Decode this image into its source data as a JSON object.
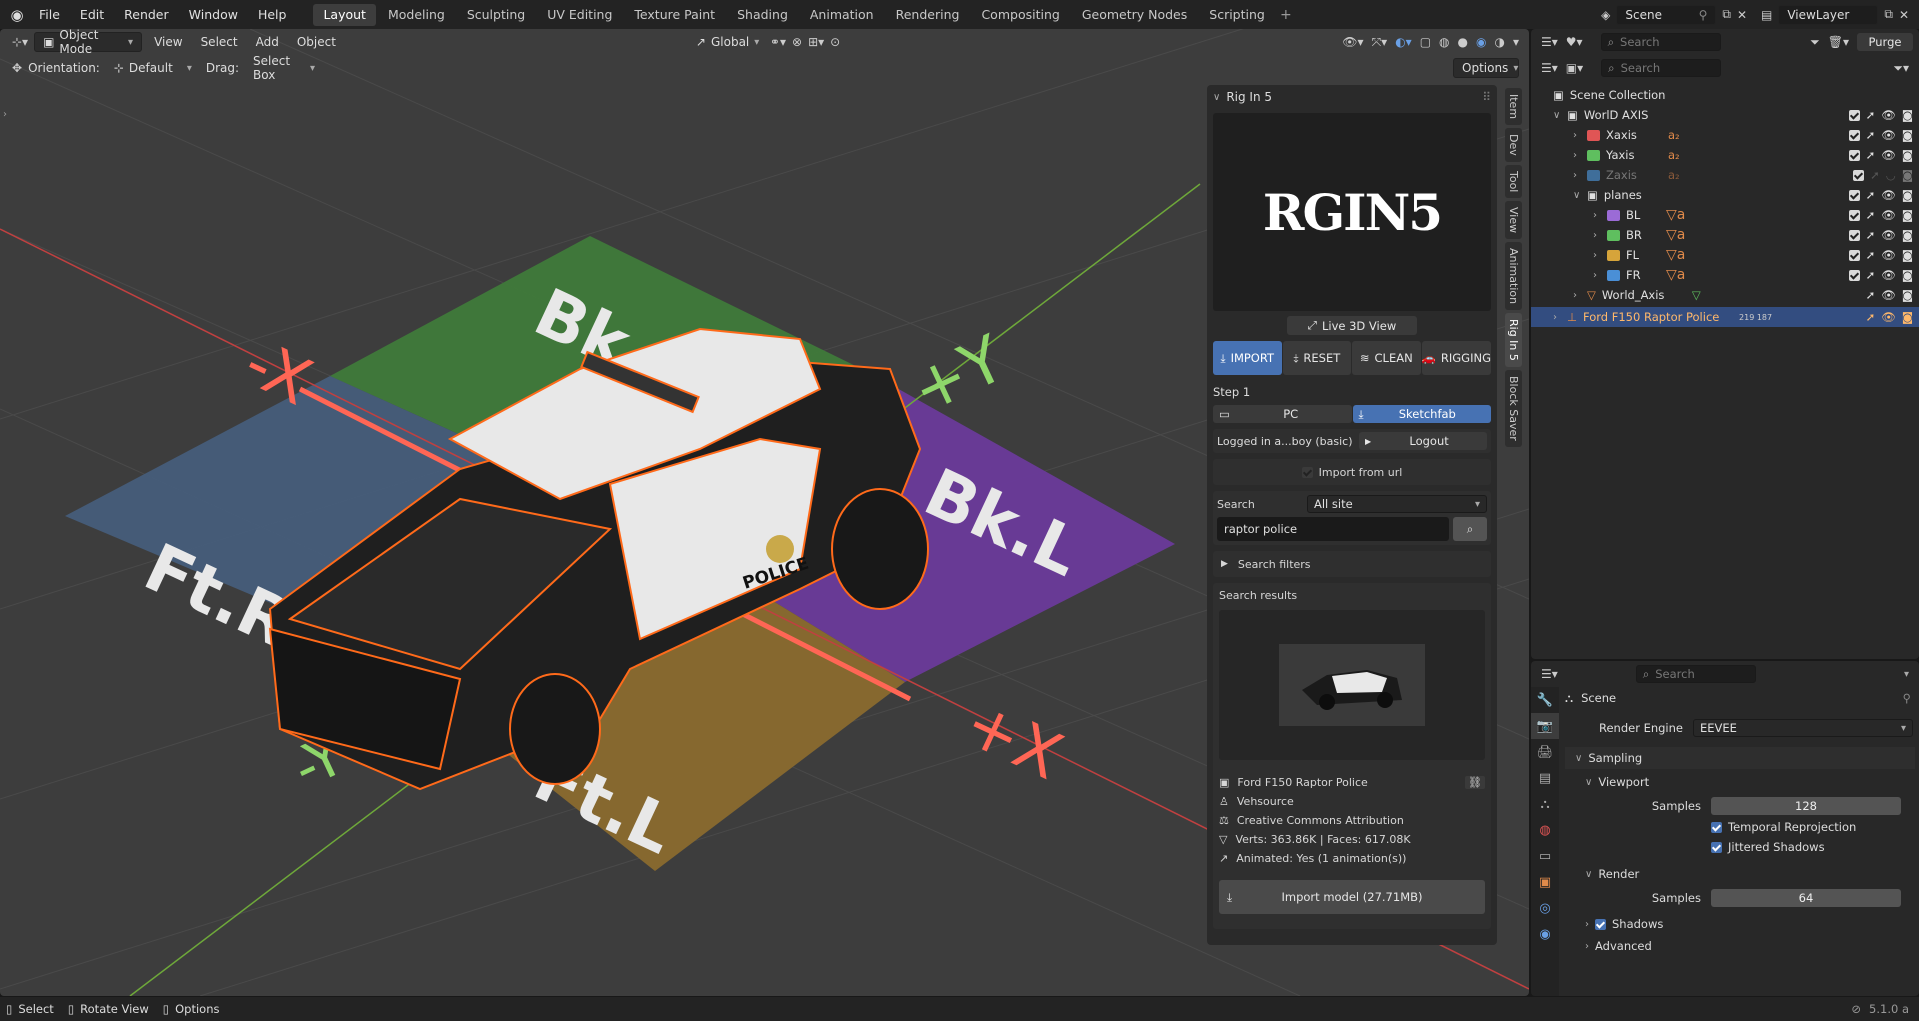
{
  "menus": [
    "File",
    "Edit",
    "Render",
    "Window",
    "Help"
  ],
  "workspaces": [
    "Layout",
    "Modeling",
    "Sculpting",
    "UV Editing",
    "Texture Paint",
    "Shading",
    "Animation",
    "Rendering",
    "Compositing",
    "Geometry Nodes",
    "Scripting"
  ],
  "active_workspace": "Layout",
  "scene_name": "Scene",
  "view_layer": "ViewLayer",
  "viewport": {
    "mode": "Object Mode",
    "menus": [
      "View",
      "Select",
      "Add",
      "Object"
    ],
    "transform": "Global",
    "orientation_label": "Orientation:",
    "orientation_value": "Default",
    "drag_label": "Drag:",
    "drag_value": "Select Box",
    "options": "Options",
    "axis_labels": {
      "neg_x": "-X",
      "pos_x": "+X",
      "pos_y": "+Y",
      "neg_y": "-Y"
    },
    "plane_labels": {
      "bl": "Bk",
      "br": "Bk.L",
      "fr": "Ft.R",
      "fl": "Ft.L"
    },
    "decal": "POLICE"
  },
  "side_tabs": [
    "Item",
    "Dev",
    "Tool",
    "View",
    "Animation",
    "Rig In 5",
    "Block Saver"
  ],
  "rig_panel": {
    "title": "Rig In 5",
    "logo_text": "RGIN5",
    "live_view": "Live 3D View",
    "tabs": [
      "IMPORT",
      "RESET",
      "CLEAN",
      "RIGGING"
    ],
    "step": "Step 1",
    "source_pc": "PC",
    "source_sketchfab": "Sketchfab",
    "logged_in": "Logged in a...boy (basic)",
    "logout": "Logout",
    "import_url": "Import from url",
    "search_label": "Search",
    "search_scope": "All site",
    "search_query": "raptor police",
    "search_filters": "Search filters",
    "results_label": "Search results",
    "result": {
      "name": "Ford F150 Raptor Police",
      "author": "Vehsource",
      "license": "Creative Commons Attribution",
      "stats": "Verts: 363.86K  |  Faces: 617.08K",
      "animated": "Animated: Yes (1 animation(s))"
    },
    "import_button": "Import model (27.71MB)"
  },
  "outliner": {
    "search_placeholder": "Search",
    "purge": "Purge",
    "items": [
      {
        "label": "Scene Collection",
        "depth": 0,
        "type": "scene"
      },
      {
        "label": "WorlD AXIS",
        "depth": 1,
        "type": "collection",
        "color": "#e0e0e0"
      },
      {
        "label": "Xaxis",
        "depth": 2,
        "type": "collection",
        "color": "#e05555",
        "extra": "a₂"
      },
      {
        "label": "Yaxis",
        "depth": 2,
        "type": "collection",
        "color": "#5fbf5f",
        "extra": "a₂"
      },
      {
        "label": "Zaxis",
        "depth": 2,
        "type": "collection",
        "color": "#4a8fd6",
        "extra": "a₂",
        "dim": true
      },
      {
        "label": "planes",
        "depth": 2,
        "type": "collection",
        "color": "#e0e0e0"
      },
      {
        "label": "BL",
        "depth": 3,
        "type": "collection",
        "color": "#9b6bd6",
        "extra": "▽a"
      },
      {
        "label": "BR",
        "depth": 3,
        "type": "collection",
        "color": "#5fbf5f",
        "extra": "▽a"
      },
      {
        "label": "FL",
        "depth": 3,
        "type": "collection",
        "color": "#d6a43a",
        "extra": "▽a"
      },
      {
        "label": "FR",
        "depth": 3,
        "type": "collection",
        "color": "#4a8fd6",
        "extra": "▽a"
      },
      {
        "label": "World_Axis",
        "depth": 2,
        "type": "object",
        "extra": "▽"
      },
      {
        "label": "Ford F150 Raptor Police",
        "depth": 1,
        "type": "object",
        "selected": true,
        "extra": "219 187"
      }
    ]
  },
  "properties": {
    "search_placeholder": "Search",
    "context": "Scene",
    "render_engine_label": "Render Engine",
    "render_engine": "EEVEE",
    "sampling": "Sampling",
    "viewport": "Viewport",
    "samples_label": "Samples",
    "viewport_samples": "128",
    "temporal_reprojection": "Temporal Reprojection",
    "jittered_shadows": "Jittered Shadows",
    "render": "Render",
    "render_samples": "64",
    "shadows": "Shadows",
    "advanced": "Advanced"
  },
  "status": {
    "select": "Select",
    "rotate": "Rotate View",
    "options": "Options",
    "version": "5.1.0 a"
  }
}
